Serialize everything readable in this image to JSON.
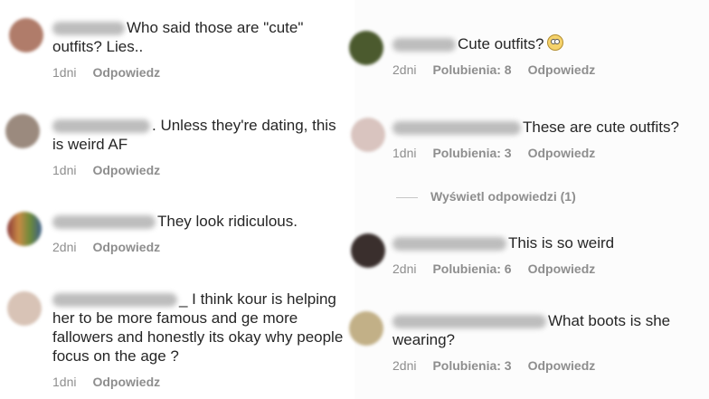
{
  "left": [
    {
      "text": "Who said those are \"cute\" outfits? Lies..",
      "time": "1dni",
      "reply": "Odpowiedz",
      "avatar_color": "#b07c6a"
    },
    {
      "text": ". Unless they're dating, this is weird AF",
      "time": "1dni",
      "reply": "Odpowiedz",
      "avatar_color": "#9b8a7e"
    },
    {
      "text": "They look ridiculous.",
      "time": "2dni",
      "reply": "Odpowiedz",
      "avatar_color": "#c98a45"
    },
    {
      "text": "_ I think kour is helping her to be more famous and ge more fallowers and honestly its okay why people focus on the age ?",
      "time": "1dni",
      "reply": "Odpowiedz",
      "avatar_color": "#d8c3b6"
    }
  ],
  "right": [
    {
      "text": "Cute outfits?",
      "time": "2dni",
      "likes": "Polubienia: 8",
      "reply": "Odpowiedz",
      "avatar_color": "#4b5a2e",
      "emoji": "face-with-rolling-eyes-icon"
    },
    {
      "text": "These are cute outfits?",
      "time": "1dni",
      "likes": "Polubienia: 3",
      "reply": "Odpowiedz",
      "avatar_color": "#d9c4bf"
    },
    {
      "text": "This is so weird",
      "time": "2dni",
      "likes": "Polubienia: 6",
      "reply": "Odpowiedz",
      "avatar_color": "#3a2f2d"
    },
    {
      "text": "What boots is she wearing?",
      "time": "2dni",
      "likes": "Polubienia: 3",
      "reply": "Odpowiedz",
      "avatar_color": "#c2b087"
    }
  ],
  "view_replies": "Wyświetl odpowiedzi (1)"
}
